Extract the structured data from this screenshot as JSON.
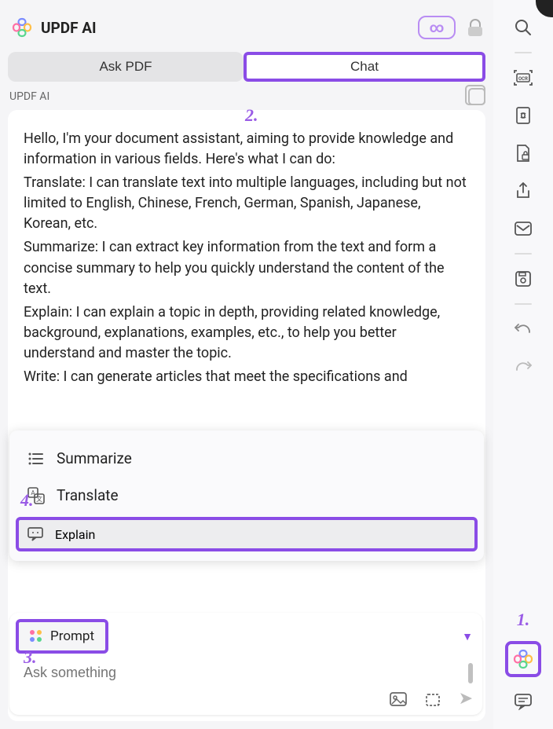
{
  "header": {
    "title": "UPDF AI",
    "infinity": "∞"
  },
  "tabs": {
    "ask": "Ask PDF",
    "chat": "Chat"
  },
  "ai_label": "UPDF AI",
  "message": {
    "intro": "Hello, I'm your document assistant, aiming to provide knowledge and information in various fields. Here's what I can do:",
    "translate": "Translate: I can translate text into multiple languages, including but not limited to English, Chinese, French, German, Spanish, Japanese, Korean, etc.",
    "summarize": "Summarize: I can extract key information from the text and form a concise summary to help you quickly understand the content of the text.",
    "explain": "Explain: I can explain a topic in depth, providing related knowledge, background, explanations, examples, etc., to help you better understand and master the topic.",
    "write": "Write: I can generate articles that meet the specifications and"
  },
  "popup": {
    "summarize": "Summarize",
    "translate": "Translate",
    "explain": "Explain"
  },
  "input": {
    "prompt_label": "Prompt",
    "placeholder": "Ask something"
  },
  "callouts": {
    "c1": "1.",
    "c2": "2.",
    "c3": "3.",
    "c4": "4."
  }
}
